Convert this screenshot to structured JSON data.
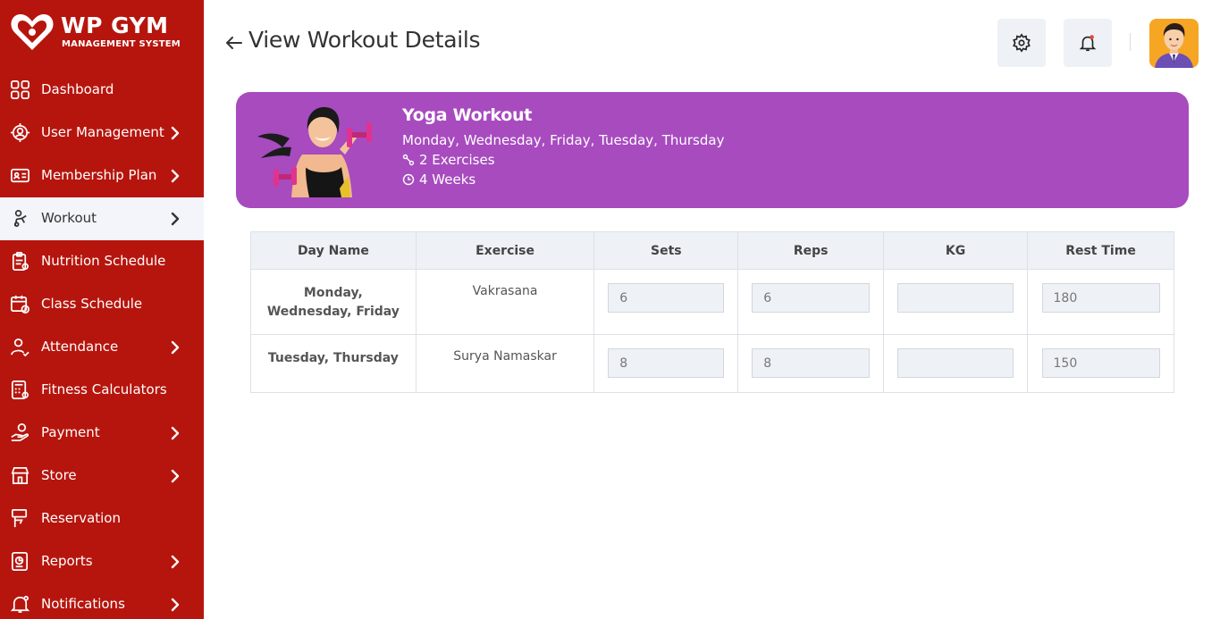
{
  "brand": {
    "title": "WP GYM",
    "subtitle": "MANAGEMENT SYSTEM"
  },
  "sidebar": {
    "items": [
      {
        "label": "Dashboard",
        "icon": "grid-icon",
        "chevron": false,
        "active": false
      },
      {
        "label": "User Management",
        "icon": "users-gear-icon",
        "chevron": true,
        "active": false
      },
      {
        "label": "Membership Plan",
        "icon": "id-card-icon",
        "chevron": true,
        "active": false
      },
      {
        "label": "Workout",
        "icon": "workout-icon",
        "chevron": true,
        "active": true
      },
      {
        "label": "Nutrition Schedule",
        "icon": "clipboard-icon",
        "chevron": false,
        "active": false
      },
      {
        "label": "Class Schedule",
        "icon": "calendar-icon",
        "chevron": false,
        "active": false
      },
      {
        "label": "Attendance",
        "icon": "user-check-icon",
        "chevron": true,
        "active": false
      },
      {
        "label": "Fitness Calculators",
        "icon": "calculator-icon",
        "chevron": false,
        "active": false
      },
      {
        "label": "Payment",
        "icon": "hand-money-icon",
        "chevron": true,
        "active": false
      },
      {
        "label": "Store",
        "icon": "store-icon",
        "chevron": true,
        "active": false
      },
      {
        "label": "Reservation",
        "icon": "reservation-icon",
        "chevron": false,
        "active": false
      },
      {
        "label": "Reports",
        "icon": "report-icon",
        "chevron": true,
        "active": false
      },
      {
        "label": "Notifications",
        "icon": "bell-icon",
        "chevron": true,
        "active": false
      }
    ]
  },
  "header": {
    "title": "View Workout Details",
    "icons": [
      "back-arrow-icon",
      "settings-icon",
      "bell-icon",
      "avatar"
    ]
  },
  "workout": {
    "title": "Yoga Workout",
    "days": "Monday, Wednesday, Friday, Tuesday, Thursday",
    "exercises": "2 Exercises",
    "weeks": "4 Weeks"
  },
  "table": {
    "headers": [
      "Day Name",
      "Exercise",
      "Sets",
      "Reps",
      "KG",
      "Rest Time"
    ],
    "rows": [
      {
        "day": "Monday, Wednesday, Friday",
        "exercise": "Vakrasana",
        "sets": "6",
        "reps": "6",
        "kg": "",
        "rest": "180"
      },
      {
        "day": "Tuesday, Thursday",
        "exercise": "Surya Namaskar",
        "sets": "8",
        "reps": "8",
        "kg": "",
        "rest": "150"
      }
    ]
  },
  "colors": {
    "sidebar": "#b6150d",
    "banner": "#a74bbf",
    "active_bg": "#f3f5fa"
  }
}
